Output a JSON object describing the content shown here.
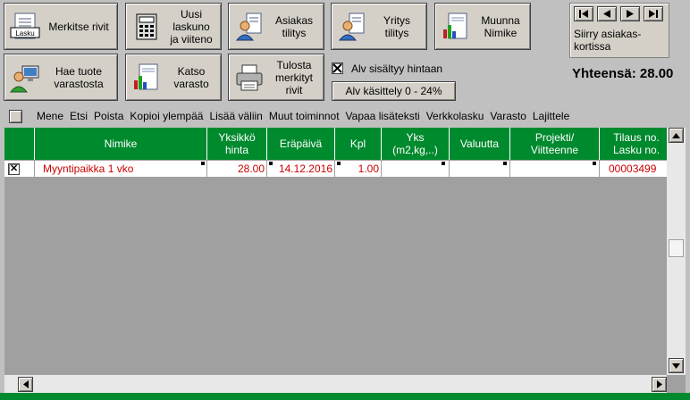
{
  "toolbar": {
    "row1": [
      {
        "label": "Merkitse rivit",
        "icon": "invoice-document-icon",
        "badge": "Lasku"
      },
      {
        "label": "Uusi\nlaskuno\nja viiteno",
        "icon": "calculator-icon"
      },
      {
        "label": "Asiakas\ntilitys",
        "icon": "customer-person-icon"
      },
      {
        "label": "Yritys\ntilitys",
        "icon": "company-person-icon"
      },
      {
        "label": "Muunna\nNimike",
        "icon": "document-chart-icon"
      }
    ],
    "row2": [
      {
        "label": "Hae tuote\nvarastosta",
        "icon": "person-computer-icon"
      },
      {
        "label": "Katso\nvarasto",
        "icon": "chart-report-icon"
      },
      {
        "label": "Tulosta\nmerkityt\nrivit",
        "icon": "printer-icon"
      }
    ]
  },
  "vat": {
    "checkbox_label": "Alv sisältyy hintaan",
    "checked": true,
    "handling_button": "Alv käsittely 0 - 24%"
  },
  "navigator": {
    "label": "Siirry asiakas-\nkortissa",
    "buttons": [
      "first",
      "previous",
      "next",
      "last"
    ]
  },
  "total": {
    "text": "Yhteensä: 28.00"
  },
  "menu": {
    "items": [
      "Mene",
      "Etsi",
      "Poista",
      "Kopioi ylempää",
      "Lisää väliin",
      "Muut toiminnot",
      "Vapaa lisäteksti",
      "Verkkolasku",
      "Varasto",
      "Lajittele"
    ]
  },
  "grid": {
    "columns": [
      "",
      "Nimike",
      "Yksikkö\nhinta",
      "Eräpäivä",
      "Kpl",
      "Yks\n(m2,kg,..)",
      "Valuutta",
      "Projekti/\nViitteenne",
      "Tilaus no.\nLasku no."
    ],
    "rows": [
      {
        "marked": "✕",
        "nimike": "Myyntipaikka 1 vko",
        "hinta": "28.00",
        "erapaiva": "14.12.2016",
        "kpl": "1.00",
        "yks": "",
        "valuutta": "",
        "projekti": "",
        "tilaus": "00003499"
      }
    ]
  },
  "colors": {
    "header_green": "#008a2e",
    "cell_text_red": "#cc0000",
    "window_gray": "#c0c0c0"
  }
}
